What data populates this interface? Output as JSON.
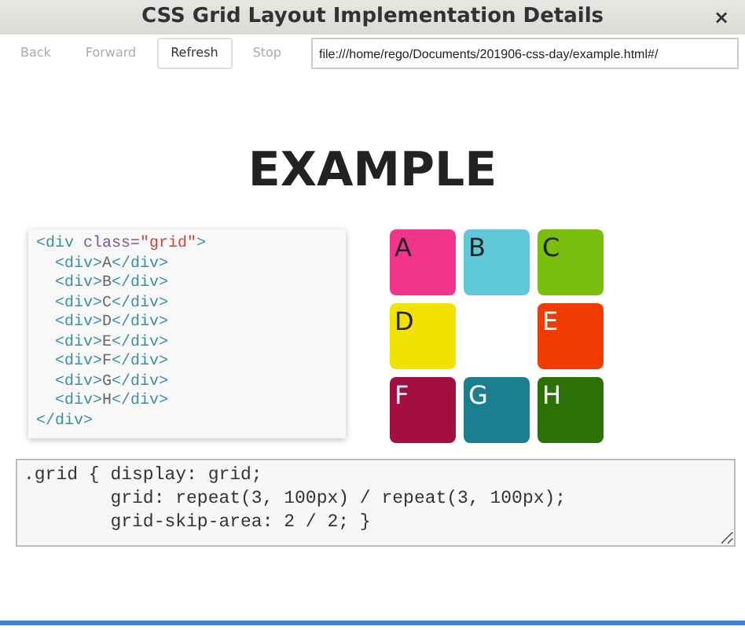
{
  "window": {
    "title": "CSS Grid Layout Implementation Details",
    "close": "×"
  },
  "toolbar": {
    "buttons": [
      {
        "label": "Back",
        "disabled": true
      },
      {
        "label": "Forward",
        "disabled": true
      },
      {
        "label": "Refresh",
        "disabled": false
      },
      {
        "label": "Stop",
        "disabled": true
      }
    ],
    "address": "file:///home/rego/Documents/201906-css-day/example.html#/"
  },
  "heading": "EXAMPLE",
  "html_code": [
    [
      {
        "kind": "tag",
        "text": "<div "
      },
      {
        "kind": "attr",
        "text": "class="
      },
      {
        "kind": "value",
        "text": "\"grid\""
      },
      {
        "kind": "tag",
        "text": ">"
      }
    ],
    [
      {
        "kind": "tag",
        "text": "  <div>"
      },
      {
        "kind": "text",
        "text": "A"
      },
      {
        "kind": "tag",
        "text": "</div>"
      }
    ],
    [
      {
        "kind": "tag",
        "text": "  <div>"
      },
      {
        "kind": "text",
        "text": "B"
      },
      {
        "kind": "tag",
        "text": "</div>"
      }
    ],
    [
      {
        "kind": "tag",
        "text": "  <div>"
      },
      {
        "kind": "text",
        "text": "C"
      },
      {
        "kind": "tag",
        "text": "</div>"
      }
    ],
    [
      {
        "kind": "tag",
        "text": "  <div>"
      },
      {
        "kind": "text",
        "text": "D"
      },
      {
        "kind": "tag",
        "text": "</div>"
      }
    ],
    [
      {
        "kind": "tag",
        "text": "  <div>"
      },
      {
        "kind": "text",
        "text": "E"
      },
      {
        "kind": "tag",
        "text": "</div>"
      }
    ],
    [
      {
        "kind": "tag",
        "text": "  <div>"
      },
      {
        "kind": "text",
        "text": "F"
      },
      {
        "kind": "tag",
        "text": "</div>"
      }
    ],
    [
      {
        "kind": "tag",
        "text": "  <div>"
      },
      {
        "kind": "text",
        "text": "G"
      },
      {
        "kind": "tag",
        "text": "</div>"
      }
    ],
    [
      {
        "kind": "tag",
        "text": "  <div>"
      },
      {
        "kind": "text",
        "text": "H"
      },
      {
        "kind": "tag",
        "text": "</div>"
      }
    ],
    [
      {
        "kind": "tag",
        "text": "</div>"
      }
    ]
  ],
  "grid_items": [
    {
      "kind": "tile",
      "label": "A",
      "color": "#f0358a"
    },
    {
      "kind": "tile",
      "label": "B",
      "color": "#5fc8d8"
    },
    {
      "kind": "tile",
      "label": "C",
      "color": "#7abf0e"
    },
    {
      "kind": "tile",
      "label": "D",
      "color": "#f2e200"
    },
    {
      "kind": "empty"
    },
    {
      "kind": "tile",
      "label": "E",
      "color": "#f03c02"
    },
    {
      "kind": "tile",
      "label": "F",
      "color": "#a30f3e"
    },
    {
      "kind": "tile",
      "label": "G",
      "color": "#1a8090"
    },
    {
      "kind": "tile",
      "label": "H",
      "color": "#2c7106"
    }
  ],
  "css_editor": {
    "value": ".grid { display: grid;\n        grid: repeat(3, 100px) / repeat(3, 100px);\n        grid-skip-area: 2 / 2; }"
  }
}
